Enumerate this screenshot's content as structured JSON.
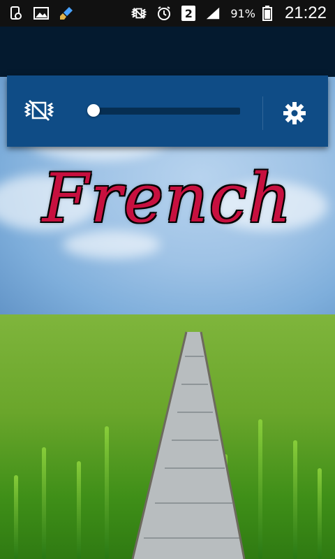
{
  "status_bar": {
    "battery_percent": "91%",
    "signal_badge": "2",
    "time": "21:22",
    "icons": [
      "device-icon",
      "gallery-icon",
      "cleaner-icon",
      "vibrate-off-icon",
      "alarm-icon",
      "sim-icon",
      "signal-icon",
      "battery-icon"
    ]
  },
  "controls": {
    "mute_icon": "vibrate-off-icon",
    "settings_icon": "gear-icon",
    "volume_level": 0.0
  },
  "title": "French",
  "colors": {
    "card": "#0f4c86",
    "header": "#041a2f",
    "title": "#c7103f"
  }
}
